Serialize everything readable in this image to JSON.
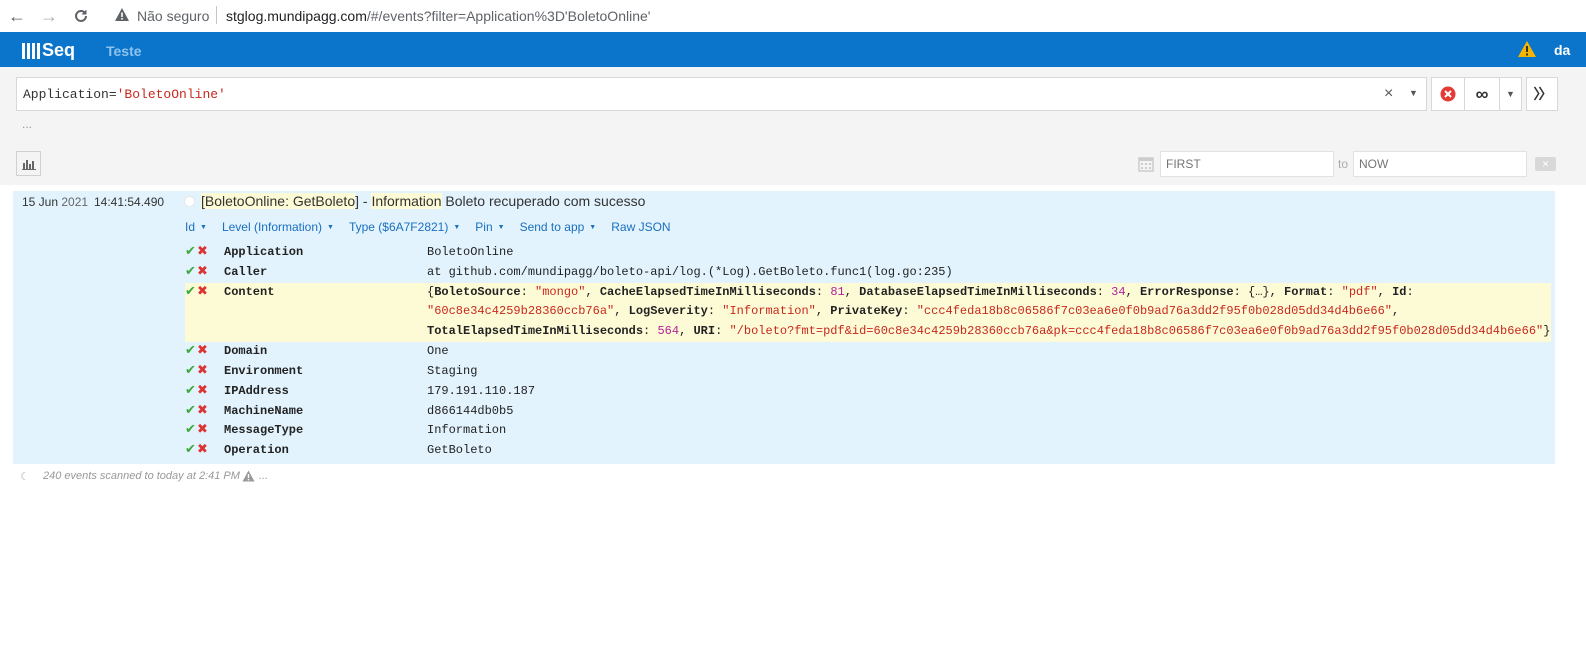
{
  "browser": {
    "insecure_label": "Não seguro",
    "url_host": "stglog.mundipagg.com",
    "url_path": "/#/events?filter=Application%3D'BoletoOnline'"
  },
  "header": {
    "logo": "Seq",
    "workspace": "Teste",
    "user": "da"
  },
  "filter": {
    "query_key": "Application=",
    "query_value": "'BoletoOnline'",
    "more": "...",
    "date_from_placeholder": "FIRST",
    "to_label": "to",
    "date_to_placeholder": "NOW"
  },
  "event": {
    "date_day": "15 Jun",
    "date_year": "2021",
    "time": "14:41:54.490",
    "msg_bracket_open": "[",
    "msg_app": "BoletoOnline",
    "msg_colon": ": ",
    "msg_op": "GetBoleto",
    "msg_bracket_close": "]",
    "msg_dash": " - ",
    "msg_level": "Information",
    "msg_text": " Boleto recuperado com sucesso",
    "actions": [
      "Id",
      "Level (Information)",
      "Type ($6A7F2821)",
      "Pin",
      "Send to app",
      "Raw JSON"
    ],
    "properties": [
      {
        "name": "Application",
        "value": "BoletoOnline"
      },
      {
        "name": "Caller",
        "value": "at github.com/mundipagg/boleto-api/log.(*Log).GetBoleto.func1(log.go:235)"
      },
      {
        "name": "Content",
        "value": ""
      },
      {
        "name": "Domain",
        "value": "One"
      },
      {
        "name": "Environment",
        "value": "Staging"
      },
      {
        "name": "IPAddress",
        "value": "179.191.110.187"
      },
      {
        "name": "MachineName",
        "value": "d866144db0b5"
      },
      {
        "name": "MessageType",
        "value": "Information"
      },
      {
        "name": "Operation",
        "value": "GetBoleto"
      }
    ],
    "content": {
      "l1": [
        {
          "t": "{",
          "c": ""
        },
        {
          "t": "BoletoSource",
          "c": "k"
        },
        {
          "t": ": ",
          "c": ""
        },
        {
          "t": "\"mongo\"",
          "c": "s"
        },
        {
          "t": ", ",
          "c": ""
        },
        {
          "t": "CacheElapsedTimeInMilliseconds",
          "c": "k"
        },
        {
          "t": ": ",
          "c": ""
        },
        {
          "t": "81",
          "c": "n"
        },
        {
          "t": ", ",
          "c": ""
        },
        {
          "t": "DatabaseElapsedTimeInMilliseconds",
          "c": "k"
        },
        {
          "t": ": ",
          "c": ""
        },
        {
          "t": "34",
          "c": "n"
        },
        {
          "t": ", ",
          "c": ""
        },
        {
          "t": "ErrorResponse",
          "c": "k"
        },
        {
          "t": ": {…}, ",
          "c": ""
        },
        {
          "t": "Format",
          "c": "k"
        },
        {
          "t": ": ",
          "c": ""
        },
        {
          "t": "\"pdf\"",
          "c": "s"
        },
        {
          "t": ", ",
          "c": ""
        },
        {
          "t": "Id",
          "c": "k"
        },
        {
          "t": ":",
          "c": ""
        }
      ],
      "l2": [
        {
          "t": "\"60c8e34c4259b28360ccb76a\"",
          "c": "s"
        },
        {
          "t": ", ",
          "c": ""
        },
        {
          "t": "LogSeverity",
          "c": "k"
        },
        {
          "t": ": ",
          "c": ""
        },
        {
          "t": "\"Information\"",
          "c": "s"
        },
        {
          "t": ", ",
          "c": ""
        },
        {
          "t": "PrivateKey",
          "c": "k"
        },
        {
          "t": ": ",
          "c": ""
        },
        {
          "t": "\"ccc4feda18b8c06586f7c03ea6e0f0b9ad76a3dd2f95f0b028d05dd34d4b6e66\"",
          "c": "s"
        },
        {
          "t": ",",
          "c": ""
        }
      ],
      "l3": [
        {
          "t": "TotalElapsedTimeInMilliseconds",
          "c": "k"
        },
        {
          "t": ": ",
          "c": ""
        },
        {
          "t": "564",
          "c": "n"
        },
        {
          "t": ", ",
          "c": ""
        },
        {
          "t": "URI",
          "c": "k"
        },
        {
          "t": ": ",
          "c": ""
        },
        {
          "t": "\"/boleto?fmt=pdf&id=60c8e34c4259b28360ccb76a&pk=ccc4feda18b8c06586f7c03ea6e0f0b9ad76a3dd2f95f0b028d05dd34d4b6e66\"",
          "c": "s"
        },
        {
          "t": "}",
          "c": ""
        }
      ]
    }
  },
  "status": {
    "text": "240 events scanned to today at 2:41 PM",
    "more": "..."
  },
  "colors": {
    "brand": "#0b75cc",
    "event_bg": "#e2f3fd",
    "highlight": "#fdfbd6",
    "link": "#1a6fbf",
    "string": "#c8281e",
    "number": "#b4239a"
  }
}
